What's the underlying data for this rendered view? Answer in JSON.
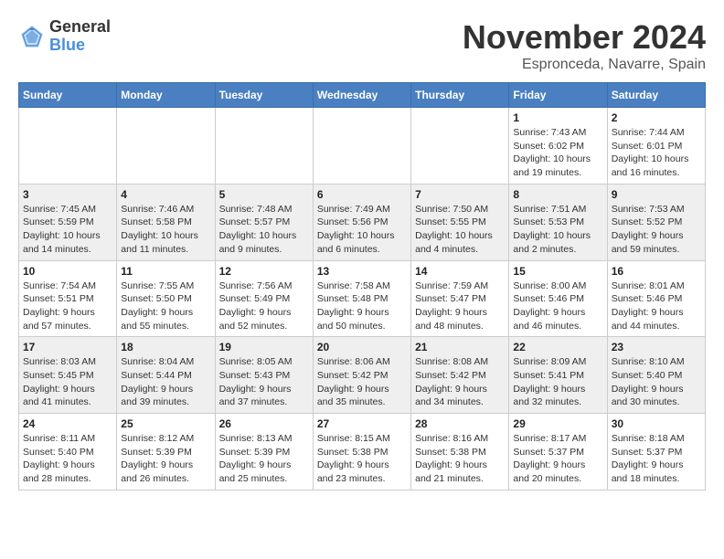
{
  "logo": {
    "general": "General",
    "blue": "Blue"
  },
  "title": "November 2024",
  "location": "Espronceda, Navarre, Spain",
  "days_of_week": [
    "Sunday",
    "Monday",
    "Tuesday",
    "Wednesday",
    "Thursday",
    "Friday",
    "Saturday"
  ],
  "weeks": [
    [
      {
        "day": "",
        "info": ""
      },
      {
        "day": "",
        "info": ""
      },
      {
        "day": "",
        "info": ""
      },
      {
        "day": "",
        "info": ""
      },
      {
        "day": "",
        "info": ""
      },
      {
        "day": "1",
        "info": "Sunrise: 7:43 AM\nSunset: 6:02 PM\nDaylight: 10 hours and 19 minutes."
      },
      {
        "day": "2",
        "info": "Sunrise: 7:44 AM\nSunset: 6:01 PM\nDaylight: 10 hours and 16 minutes."
      }
    ],
    [
      {
        "day": "3",
        "info": "Sunrise: 7:45 AM\nSunset: 5:59 PM\nDaylight: 10 hours and 14 minutes."
      },
      {
        "day": "4",
        "info": "Sunrise: 7:46 AM\nSunset: 5:58 PM\nDaylight: 10 hours and 11 minutes."
      },
      {
        "day": "5",
        "info": "Sunrise: 7:48 AM\nSunset: 5:57 PM\nDaylight: 10 hours and 9 minutes."
      },
      {
        "day": "6",
        "info": "Sunrise: 7:49 AM\nSunset: 5:56 PM\nDaylight: 10 hours and 6 minutes."
      },
      {
        "day": "7",
        "info": "Sunrise: 7:50 AM\nSunset: 5:55 PM\nDaylight: 10 hours and 4 minutes."
      },
      {
        "day": "8",
        "info": "Sunrise: 7:51 AM\nSunset: 5:53 PM\nDaylight: 10 hours and 2 minutes."
      },
      {
        "day": "9",
        "info": "Sunrise: 7:53 AM\nSunset: 5:52 PM\nDaylight: 9 hours and 59 minutes."
      }
    ],
    [
      {
        "day": "10",
        "info": "Sunrise: 7:54 AM\nSunset: 5:51 PM\nDaylight: 9 hours and 57 minutes."
      },
      {
        "day": "11",
        "info": "Sunrise: 7:55 AM\nSunset: 5:50 PM\nDaylight: 9 hours and 55 minutes."
      },
      {
        "day": "12",
        "info": "Sunrise: 7:56 AM\nSunset: 5:49 PM\nDaylight: 9 hours and 52 minutes."
      },
      {
        "day": "13",
        "info": "Sunrise: 7:58 AM\nSunset: 5:48 PM\nDaylight: 9 hours and 50 minutes."
      },
      {
        "day": "14",
        "info": "Sunrise: 7:59 AM\nSunset: 5:47 PM\nDaylight: 9 hours and 48 minutes."
      },
      {
        "day": "15",
        "info": "Sunrise: 8:00 AM\nSunset: 5:46 PM\nDaylight: 9 hours and 46 minutes."
      },
      {
        "day": "16",
        "info": "Sunrise: 8:01 AM\nSunset: 5:46 PM\nDaylight: 9 hours and 44 minutes."
      }
    ],
    [
      {
        "day": "17",
        "info": "Sunrise: 8:03 AM\nSunset: 5:45 PM\nDaylight: 9 hours and 41 minutes."
      },
      {
        "day": "18",
        "info": "Sunrise: 8:04 AM\nSunset: 5:44 PM\nDaylight: 9 hours and 39 minutes."
      },
      {
        "day": "19",
        "info": "Sunrise: 8:05 AM\nSunset: 5:43 PM\nDaylight: 9 hours and 37 minutes."
      },
      {
        "day": "20",
        "info": "Sunrise: 8:06 AM\nSunset: 5:42 PM\nDaylight: 9 hours and 35 minutes."
      },
      {
        "day": "21",
        "info": "Sunrise: 8:08 AM\nSunset: 5:42 PM\nDaylight: 9 hours and 34 minutes."
      },
      {
        "day": "22",
        "info": "Sunrise: 8:09 AM\nSunset: 5:41 PM\nDaylight: 9 hours and 32 minutes."
      },
      {
        "day": "23",
        "info": "Sunrise: 8:10 AM\nSunset: 5:40 PM\nDaylight: 9 hours and 30 minutes."
      }
    ],
    [
      {
        "day": "24",
        "info": "Sunrise: 8:11 AM\nSunset: 5:40 PM\nDaylight: 9 hours and 28 minutes."
      },
      {
        "day": "25",
        "info": "Sunrise: 8:12 AM\nSunset: 5:39 PM\nDaylight: 9 hours and 26 minutes."
      },
      {
        "day": "26",
        "info": "Sunrise: 8:13 AM\nSunset: 5:39 PM\nDaylight: 9 hours and 25 minutes."
      },
      {
        "day": "27",
        "info": "Sunrise: 8:15 AM\nSunset: 5:38 PM\nDaylight: 9 hours and 23 minutes."
      },
      {
        "day": "28",
        "info": "Sunrise: 8:16 AM\nSunset: 5:38 PM\nDaylight: 9 hours and 21 minutes."
      },
      {
        "day": "29",
        "info": "Sunrise: 8:17 AM\nSunset: 5:37 PM\nDaylight: 9 hours and 20 minutes."
      },
      {
        "day": "30",
        "info": "Sunrise: 8:18 AM\nSunset: 5:37 PM\nDaylight: 9 hours and 18 minutes."
      }
    ]
  ]
}
